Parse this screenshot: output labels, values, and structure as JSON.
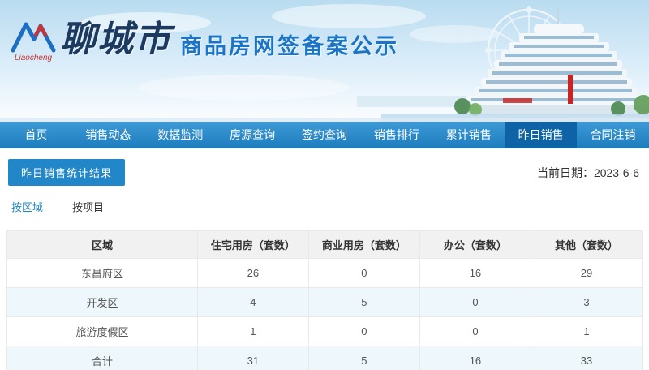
{
  "header": {
    "logo_cn": "聊城市",
    "logo_sub": "Liaocheng",
    "title": "商品房网签备案公示"
  },
  "nav": {
    "items": [
      {
        "label": "首页",
        "active": false
      },
      {
        "label": "销售动态",
        "active": false
      },
      {
        "label": "数据监测",
        "active": false
      },
      {
        "label": "房源查询",
        "active": false
      },
      {
        "label": "签约查询",
        "active": false
      },
      {
        "label": "销售排行",
        "active": false
      },
      {
        "label": "累计销售",
        "active": false
      },
      {
        "label": "昨日销售",
        "active": true
      },
      {
        "label": "合同注销",
        "active": false
      }
    ]
  },
  "content": {
    "section_title": "昨日销售统计结果",
    "current_date": "当前日期：2023-6-6",
    "tabs": [
      {
        "label": "按区域",
        "active": true
      },
      {
        "label": "按项目",
        "active": false
      }
    ]
  },
  "chart_data": {
    "type": "table",
    "columns": [
      "区域",
      "住宅用房（套数）",
      "商业用房（套数）",
      "办公（套数）",
      "其他（套数）"
    ],
    "rows": [
      [
        "东昌府区",
        "26",
        "0",
        "16",
        "29"
      ],
      [
        "开发区",
        "4",
        "5",
        "0",
        "3"
      ],
      [
        "旅游度假区",
        "1",
        "0",
        "0",
        "1"
      ],
      [
        "合计",
        "31",
        "5",
        "16",
        "33"
      ]
    ]
  },
  "colors": {
    "nav_blue": "#2285c7",
    "nav_active": "#0d63a6",
    "label_blue": "#2187c8",
    "link_blue": "#1e87c5",
    "table_header_bg": "#f1f1f1",
    "row_alt_bg": "#eef7fc",
    "title_blue": "#1b74c5"
  }
}
